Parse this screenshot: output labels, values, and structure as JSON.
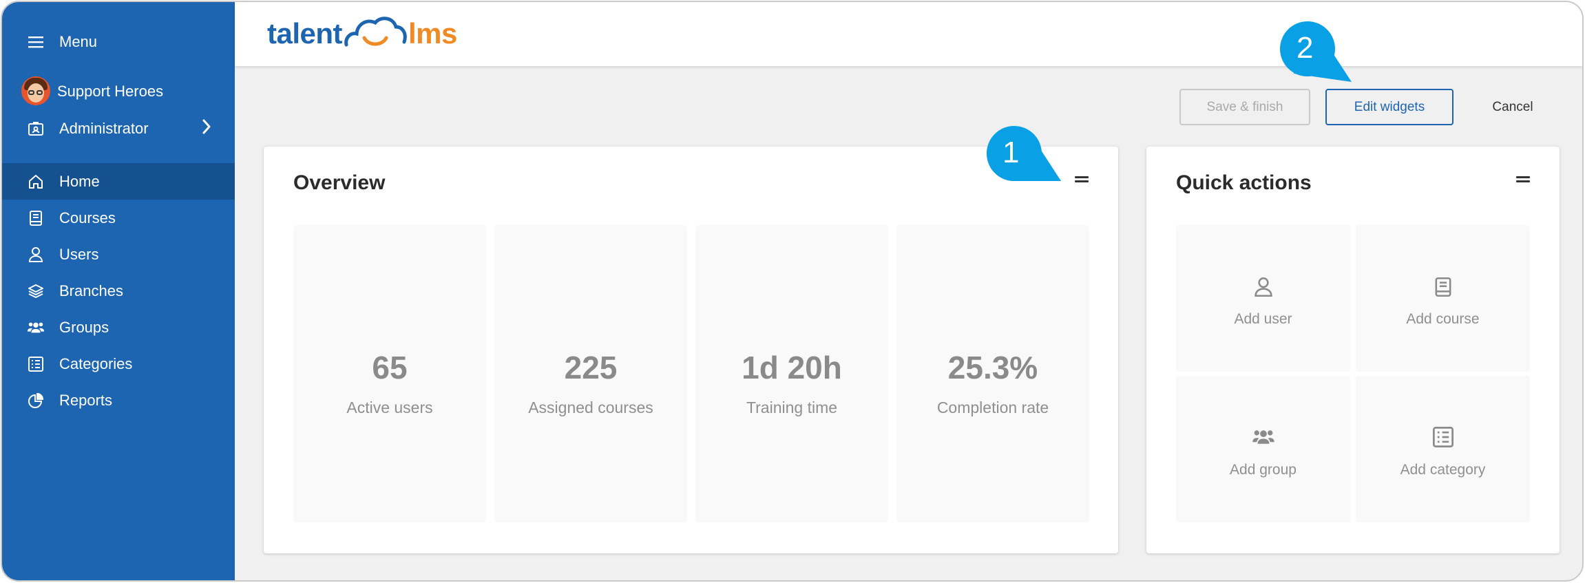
{
  "sidebar": {
    "menu_label": "Menu",
    "org_name": "Support Heroes",
    "role_label": "Administrator",
    "items": [
      {
        "label": "Home",
        "icon": "home-icon",
        "active": true
      },
      {
        "label": "Courses",
        "icon": "book-icon",
        "active": false
      },
      {
        "label": "Users",
        "icon": "user-icon",
        "active": false
      },
      {
        "label": "Branches",
        "icon": "layers-icon",
        "active": false
      },
      {
        "label": "Groups",
        "icon": "group-icon",
        "active": false
      },
      {
        "label": "Categories",
        "icon": "list-icon",
        "active": false
      },
      {
        "label": "Reports",
        "icon": "pie-chart-icon",
        "active": false
      }
    ]
  },
  "header": {
    "logo_left": "talent",
    "logo_right": "lms"
  },
  "toolbar": {
    "save_label": "Save & finish",
    "edit_label": "Edit widgets",
    "cancel_label": "Cancel"
  },
  "overview": {
    "title": "Overview",
    "stats": [
      {
        "value": "65",
        "label": "Active users"
      },
      {
        "value": "225",
        "label": "Assigned courses"
      },
      {
        "value": "1d 20h",
        "label": "Training time"
      },
      {
        "value": "25.3%",
        "label": "Completion rate"
      }
    ]
  },
  "quick_actions": {
    "title": "Quick actions",
    "items": [
      {
        "label": "Add user",
        "icon": "user-icon"
      },
      {
        "label": "Add course",
        "icon": "book-icon"
      },
      {
        "label": "Add group",
        "icon": "group-icon"
      },
      {
        "label": "Add category",
        "icon": "list-icon"
      }
    ]
  },
  "callouts": {
    "one": "1",
    "two": "2"
  },
  "colors": {
    "sidebar_bg": "#1d65b0",
    "sidebar_active": "#15518f",
    "brand_blue": "#1d65b0",
    "brand_orange": "#f08a24",
    "callout": "#0aa0e6"
  }
}
